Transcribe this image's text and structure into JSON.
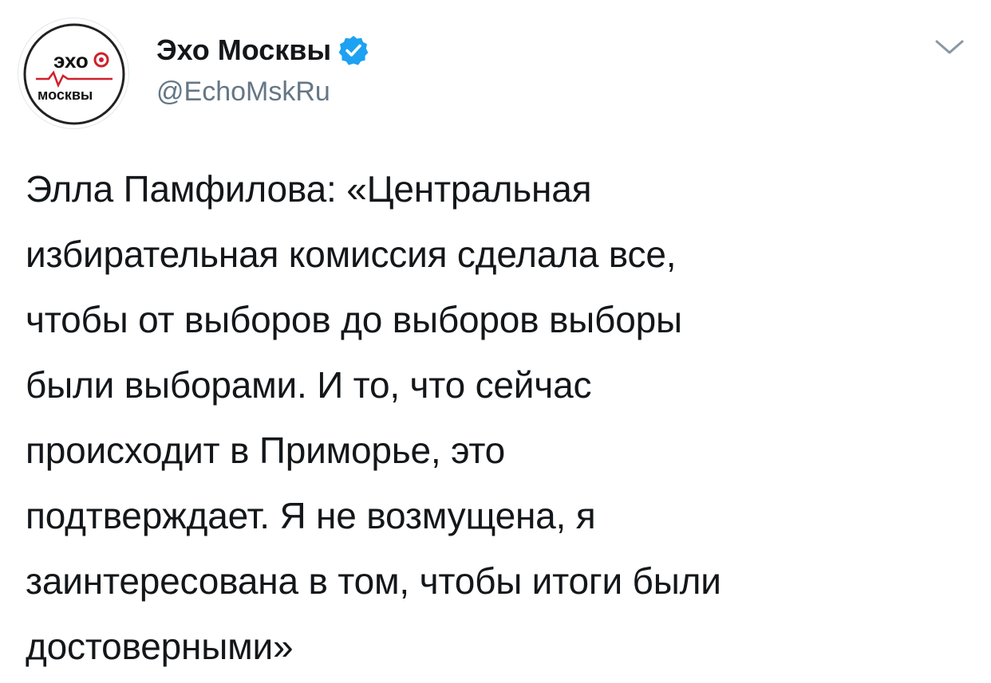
{
  "account": {
    "display_name": "Эхо Москвы",
    "handle": "@EchoMskRu",
    "verified": true,
    "avatar_logo_top": "эхо",
    "avatar_logo_bottom": "москвы"
  },
  "tweet": {
    "text": "Элла Памфилова: «Центральная\nизбирательная комиссия сделала все,\nчтобы от выборов до выборов выборы\nбыли выборами. И то, что сейчас\nпроисходит в Приморье, это\nподтверждает. Я не возмущена, я\nзаинтересована в том, чтобы итоги были\nдостоверными»"
  },
  "icons": {
    "verified": "verified-badge-icon",
    "caret": "chevron-down-icon"
  },
  "colors": {
    "text": "#14171a",
    "secondary": "#657786",
    "verified_blue": "#1da1f2",
    "logo_red": "#d0202a"
  }
}
